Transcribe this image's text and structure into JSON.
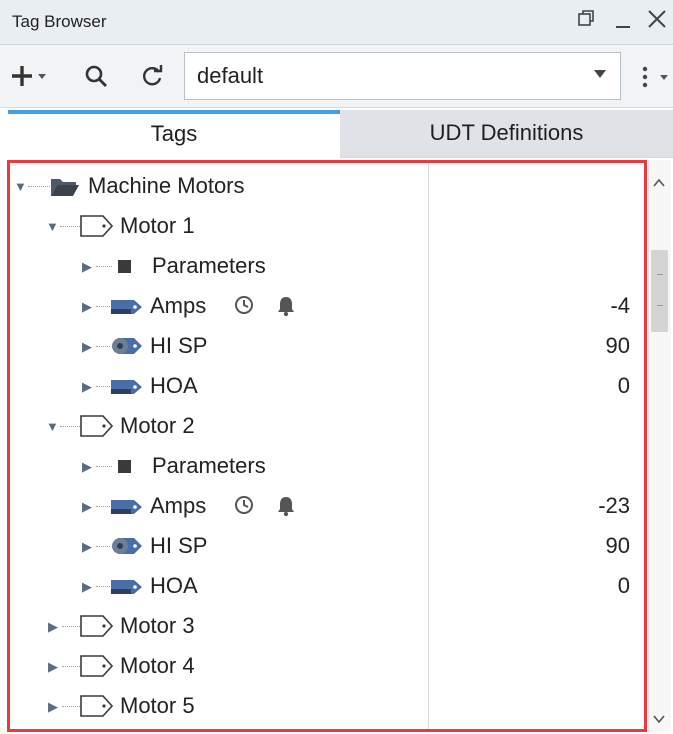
{
  "window": {
    "title": "Tag Browser",
    "restore_icon": "restore-icon",
    "minimize_icon": "minimize-icon",
    "close_icon": "close-icon"
  },
  "toolbar": {
    "add_icon": "plus-icon",
    "search_icon": "search-icon",
    "refresh_icon": "refresh-icon",
    "provider_value": "default",
    "more_icon": "more-vertical-icon"
  },
  "tabs": [
    {
      "label": "Tags",
      "active": true
    },
    {
      "label": "UDT Definitions",
      "active": false
    }
  ],
  "tree": {
    "root": {
      "label": "Machine Motors",
      "icon": "folder-open-icon",
      "expanded": true
    },
    "motor1": {
      "label": "Motor 1",
      "children": {
        "parameters": "Parameters",
        "amps": {
          "label": "Amps",
          "value": "-4"
        },
        "hisp": {
          "label": "HI SP",
          "value": "90"
        },
        "hoa": {
          "label": "HOA",
          "value": "0"
        }
      }
    },
    "motor2": {
      "label": "Motor 2",
      "children": {
        "parameters": "Parameters",
        "amps": {
          "label": "Amps",
          "value": "-23"
        },
        "hisp": {
          "label": "HI SP",
          "value": "90"
        },
        "hoa": {
          "label": "HOA",
          "value": "0"
        }
      }
    },
    "motor3": {
      "label": "Motor 3"
    },
    "motor4": {
      "label": "Motor 4"
    },
    "motor5": {
      "label": "Motor 5"
    }
  },
  "colors": {
    "highlight_border": "#ea3a3f",
    "active_tab_accent": "#3ea0e6",
    "tag_icon": "#4a6fa8"
  }
}
